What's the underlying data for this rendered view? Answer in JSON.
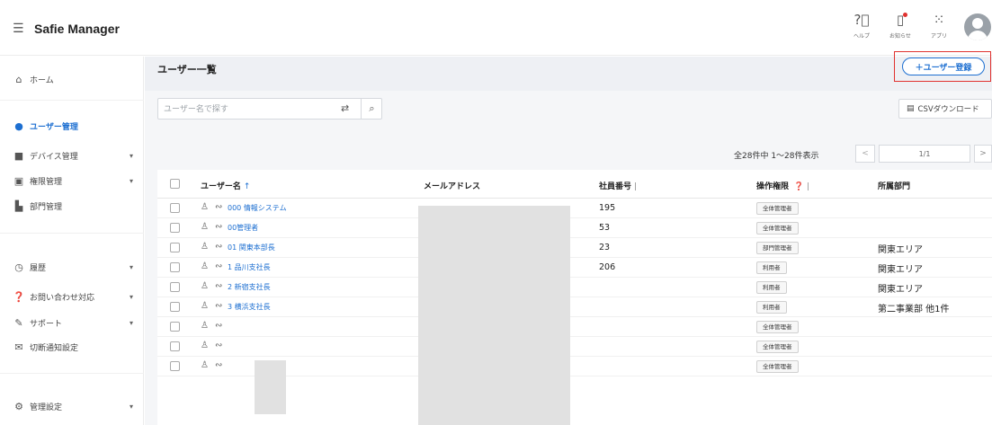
{
  "topbar": {
    "app_title": "Safie Manager",
    "help_label": "ヘルプ",
    "notice_label": "お知らせ",
    "apps_label": "アプリ"
  },
  "sidebar": {
    "items": [
      {
        "label": "ホーム",
        "icon": "home-icon"
      },
      {
        "label": "ユーザー管理",
        "icon": "user-icon",
        "active": true
      },
      {
        "label": "デバイス管理",
        "icon": "camera-icon"
      },
      {
        "label": "権限管理",
        "icon": "key-icon"
      },
      {
        "label": "部門管理",
        "icon": "building-icon"
      },
      {
        "label": "履歴",
        "icon": "clock-icon"
      },
      {
        "label": "お問い合わせ対応",
        "icon": "question-icon"
      },
      {
        "label": "サポート",
        "icon": "support-icon"
      },
      {
        "label": "切断通知設定",
        "icon": "mail-icon"
      },
      {
        "label": "管理設定",
        "icon": "gear-icon"
      }
    ]
  },
  "main": {
    "title": "ユーザー一覧",
    "add_user_label": "＋ユーザー登録",
    "search_placeholder": "ユーザー名で探す",
    "csv_label": "CSVダウンロード",
    "count_text": "全28件中 1〜28件表示",
    "page_indicator": "1/1",
    "prev_label": "<",
    "next_label": ">"
  },
  "table": {
    "headers": {
      "username": "ユーザー名",
      "email": "メールアドレス",
      "employee_no": "社員番号",
      "permission": "操作権限",
      "department": "所属部門"
    },
    "rows": [
      {
        "name": "000 情報システム",
        "employee_no": "195",
        "permission": "全体管理者",
        "department": ""
      },
      {
        "name": "00管理者",
        "employee_no": "53",
        "permission": "全体管理者",
        "department": ""
      },
      {
        "name": "01 関東本部長",
        "employee_no": "23",
        "permission": "部門管理者",
        "department": "関東エリア"
      },
      {
        "name": "1 品川支社長",
        "employee_no": "206",
        "permission": "利用者",
        "department": "関東エリア"
      },
      {
        "name": "2 新宿支社長",
        "employee_no": "",
        "permission": "利用者",
        "department": "関東エリア"
      },
      {
        "name": "3 横浜支社長",
        "employee_no": "",
        "permission": "利用者",
        "department": "第二事業部 他1件"
      },
      {
        "name": "",
        "employee_no": "",
        "permission": "全体管理者",
        "department": ""
      },
      {
        "name": "",
        "employee_no": "",
        "permission": "全体管理者",
        "department": ""
      },
      {
        "name": "",
        "employee_no": "",
        "permission": "全体管理者",
        "department": ""
      }
    ]
  },
  "colors": {
    "accent": "#1d6fd1",
    "highlight_border": "#e0322f"
  }
}
